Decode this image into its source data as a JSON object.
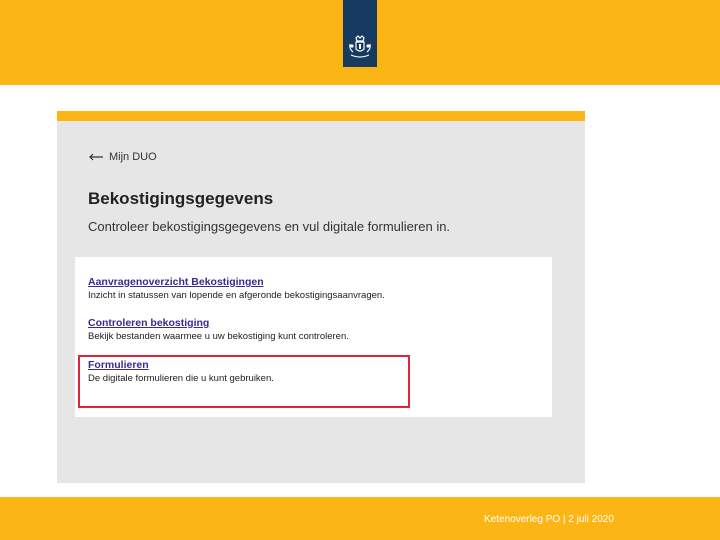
{
  "header": {
    "logo_icon": "coat-of-arms-icon",
    "band_color": "#fbb615",
    "ribbon_color": "#173a60"
  },
  "screenshot": {
    "back_link": {
      "icon": "arrow-left-icon",
      "label": "Mijn DUO"
    },
    "title": "Bekostigingsgegevens",
    "subtitle": "Controleer bekostigingsgegevens en vul digitale formulieren in.",
    "items": [
      {
        "link": "Aanvragenoverzicht Bekostigingen",
        "description": "Inzicht in statussen van lopende en afgeronde bekostigingsaanvragen."
      },
      {
        "link": "Controleren bekostiging",
        "description": "Bekijk bestanden waarmee u uw bekostiging kunt controleren."
      },
      {
        "link": "Formulieren",
        "description": "De digitale formulieren die u kunt gebruiken."
      }
    ],
    "highlight_color": "#e0243a",
    "link_color": "#3b2a8f"
  },
  "footer": {
    "text": "Ketenoverleg PO | 2 juli 2020"
  }
}
